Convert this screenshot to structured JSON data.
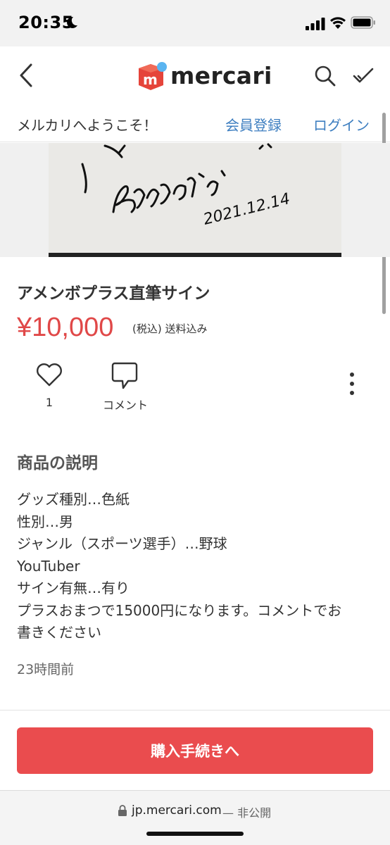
{
  "status_bar": {
    "time": "20:35"
  },
  "header": {
    "logo_text": "mercari",
    "brand_red": "#e5443a",
    "brand_blue": "#5ab4f0"
  },
  "welcome_bar": {
    "message": "メルカリへようこそ！",
    "register_label": "会員登録",
    "login_label": "ログイン",
    "link_color": "#3d7ec0"
  },
  "photo": {
    "signature_date": "2021.12.14"
  },
  "product": {
    "title": "アメンボプラス直筆サイン",
    "price": "¥10,000",
    "tax_note": "(税込) 送料込み",
    "price_color": "#e04848"
  },
  "actions": {
    "like_count": "1",
    "comment_label": "コメント"
  },
  "description": {
    "heading": "商品の説明",
    "lines": [
      "グッズ種別…色紙",
      "性別…男",
      "ジャンル（スポーツ選手）…野球",
      "YouTuber",
      "サイン有無…有り",
      "プラスおまつで15000円になります。コメントでお",
      "書きください"
    ],
    "posted": "23時間前"
  },
  "purchase": {
    "button_label": "購入手続きへ",
    "button_color": "#ea4c4e"
  },
  "browser": {
    "url": "jp.mercari.com",
    "privacy": "— 非公開"
  }
}
